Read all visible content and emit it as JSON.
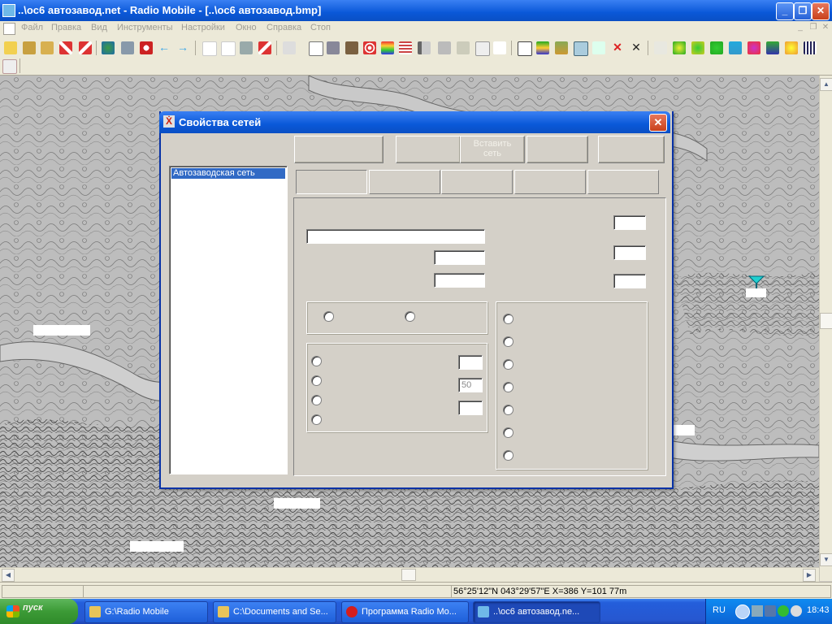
{
  "window": {
    "title": "..\\oc6 автозавод.net - Radio Mobile - [..\\oc6 автозавод.bmp]",
    "minimize_glyph": "_",
    "restore_glyph": "❐",
    "close_glyph": "✕"
  },
  "menu": {
    "items": [
      "Файл",
      "Правка",
      "Вид",
      "Инструменты",
      "Настройки",
      "Окно",
      "Справка",
      "Стоп"
    ],
    "mdi_minimize": "_",
    "mdi_restore": "❐",
    "mdi_close": "✕"
  },
  "dialog": {
    "title": "Свойства сетей",
    "close_glyph": "✕",
    "icon_glyph": "Ẋ",
    "network_list_label": "",
    "networks": [
      "Автозаводская сеть"
    ],
    "top_buttons": [
      {
        "label_line1": "",
        "label_line2": ""
      },
      {
        "label_line1": "",
        "label_line2": ""
      },
      {
        "label_line1": "Вставить",
        "label_line2": "сеть"
      },
      {
        "label_line1": "",
        "label_line2": ""
      },
      {
        "label_line1": "",
        "label_line2": ""
      }
    ],
    "tabs": [
      "",
      "",
      "",
      "",
      ""
    ],
    "fields": {
      "network_name_label": "",
      "network_name_value": "",
      "min_freq_label": "",
      "min_freq_value": "",
      "max_freq_label": "",
      "max_freq_value": "",
      "right_field1_label": "",
      "right_field1_value": "",
      "right_field2_label": "",
      "right_field2_value": "",
      "right_field3_label": "",
      "right_field3_value": ""
    },
    "polarization_group": {
      "title": "",
      "options": [
        "",
        ""
      ]
    },
    "mode_group": {
      "title": "",
      "options": [
        "",
        "",
        "",
        ""
      ],
      "inputs": [
        {
          "label": "",
          "value": ""
        },
        {
          "label": "",
          "value": "50"
        },
        {
          "label": "",
          "value": ""
        }
      ]
    },
    "climate_group": {
      "title": "",
      "options": [
        "",
        "",
        "",
        "",
        "",
        "",
        ""
      ]
    }
  },
  "statusbar": {
    "panel1": "",
    "panel2": "",
    "coords": "56°25'12\"N 043°29'57\"E  X=386 Y=101 77m"
  },
  "taskbar": {
    "start_label": "пуск",
    "tasks": [
      {
        "label": "G:\\Radio Mobile",
        "color": "#e8c45a"
      },
      {
        "label": "C:\\Documents and Se...",
        "color": "#e8c45a"
      },
      {
        "label": "Программа Radio Mo...",
        "color": "#d41e1e"
      },
      {
        "label": "..\\oc6 автозавод.ne...",
        "color": "#6fb9e8"
      }
    ],
    "lang": "RU",
    "clock": "18:43"
  },
  "colors": {
    "titlebar": "#0a58d8",
    "selection": "#316ac5",
    "map_background": "#b9b9b9",
    "marker": "#20d0d0"
  }
}
